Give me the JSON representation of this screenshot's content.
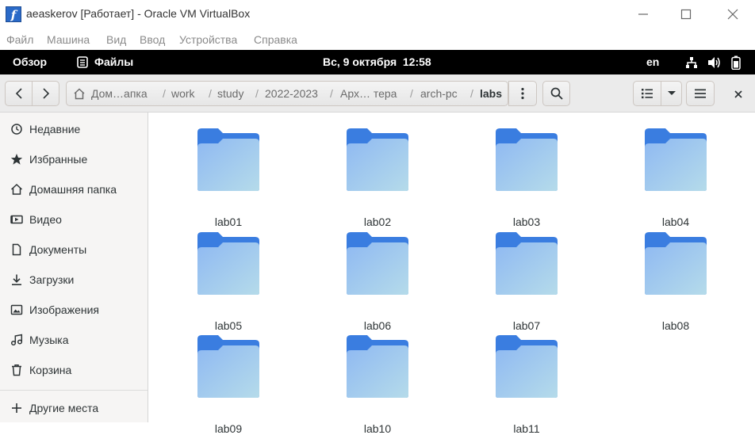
{
  "window": {
    "title": "aeaskerov [Работает] - Oracle VM VirtualBox"
  },
  "menubar": {
    "items": [
      "Файл",
      "Машина",
      "Вид",
      "Ввод",
      "Устройства",
      "Справка"
    ]
  },
  "gnome_bar": {
    "activities": "Обзор",
    "app_name": "Файлы",
    "clock": "Вс, 9 октября  12:58",
    "keyboard_layout": "en"
  },
  "pathbar": {
    "crumbs": [
      "Дом…апка",
      "work",
      "study",
      "2022-2023",
      "Арх… тера",
      "arch-pc",
      "labs"
    ]
  },
  "sidebar": {
    "items": [
      {
        "label": "Недавние",
        "icon": "clock-icon"
      },
      {
        "label": "Избранные",
        "icon": "star-icon"
      },
      {
        "label": "Домашняя папка",
        "icon": "home-icon"
      },
      {
        "label": "Видео",
        "icon": "video-icon"
      },
      {
        "label": "Документы",
        "icon": "document-icon"
      },
      {
        "label": "Загрузки",
        "icon": "download-icon"
      },
      {
        "label": "Изображения",
        "icon": "image-icon"
      },
      {
        "label": "Музыка",
        "icon": "music-icon"
      },
      {
        "label": "Корзина",
        "icon": "trash-icon"
      }
    ],
    "other_locations": "Другие места"
  },
  "files": [
    "lab01",
    "lab02",
    "lab03",
    "lab04",
    "lab05",
    "lab06",
    "lab07",
    "lab08",
    "lab09",
    "lab10",
    "lab11"
  ],
  "colors": {
    "folder_top": "#3a7de0",
    "folder_front_top": "#8fb9f2",
    "folder_front_bottom": "#b5dbea",
    "top_bar": "#000000"
  }
}
